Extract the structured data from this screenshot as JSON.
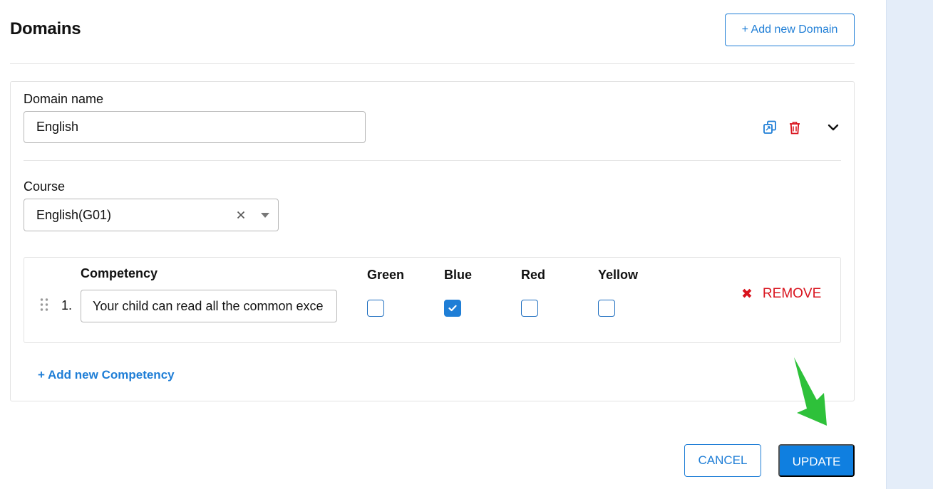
{
  "header": {
    "title": "Domains",
    "add_domain_label": "+ Add new Domain"
  },
  "domain": {
    "name_label": "Domain name",
    "name_value": "English",
    "actions": {
      "copy_icon": "copy-icon",
      "delete_icon": "trash-icon",
      "expand_icon": "chevron-down-icon"
    },
    "course_label": "Course",
    "course_value": "English(G01)",
    "competency_table": {
      "headers": {
        "competency": "Competency",
        "green": "Green",
        "blue": "Blue",
        "red": "Red",
        "yellow": "Yellow"
      },
      "rows": [
        {
          "number": "1.",
          "text": "Your child can read all the common exce",
          "green": false,
          "blue": true,
          "red": false,
          "yellow": false,
          "remove_label": "REMOVE"
        }
      ]
    },
    "add_competency_label": "+ Add new Competency"
  },
  "footer": {
    "cancel_label": "CANCEL",
    "update_label": "UPDATE"
  },
  "colors": {
    "accent": "#1f7ed6",
    "danger": "#d9141e",
    "annotation_arrow": "#2ec13a",
    "side_panel": "#e4edf9"
  }
}
